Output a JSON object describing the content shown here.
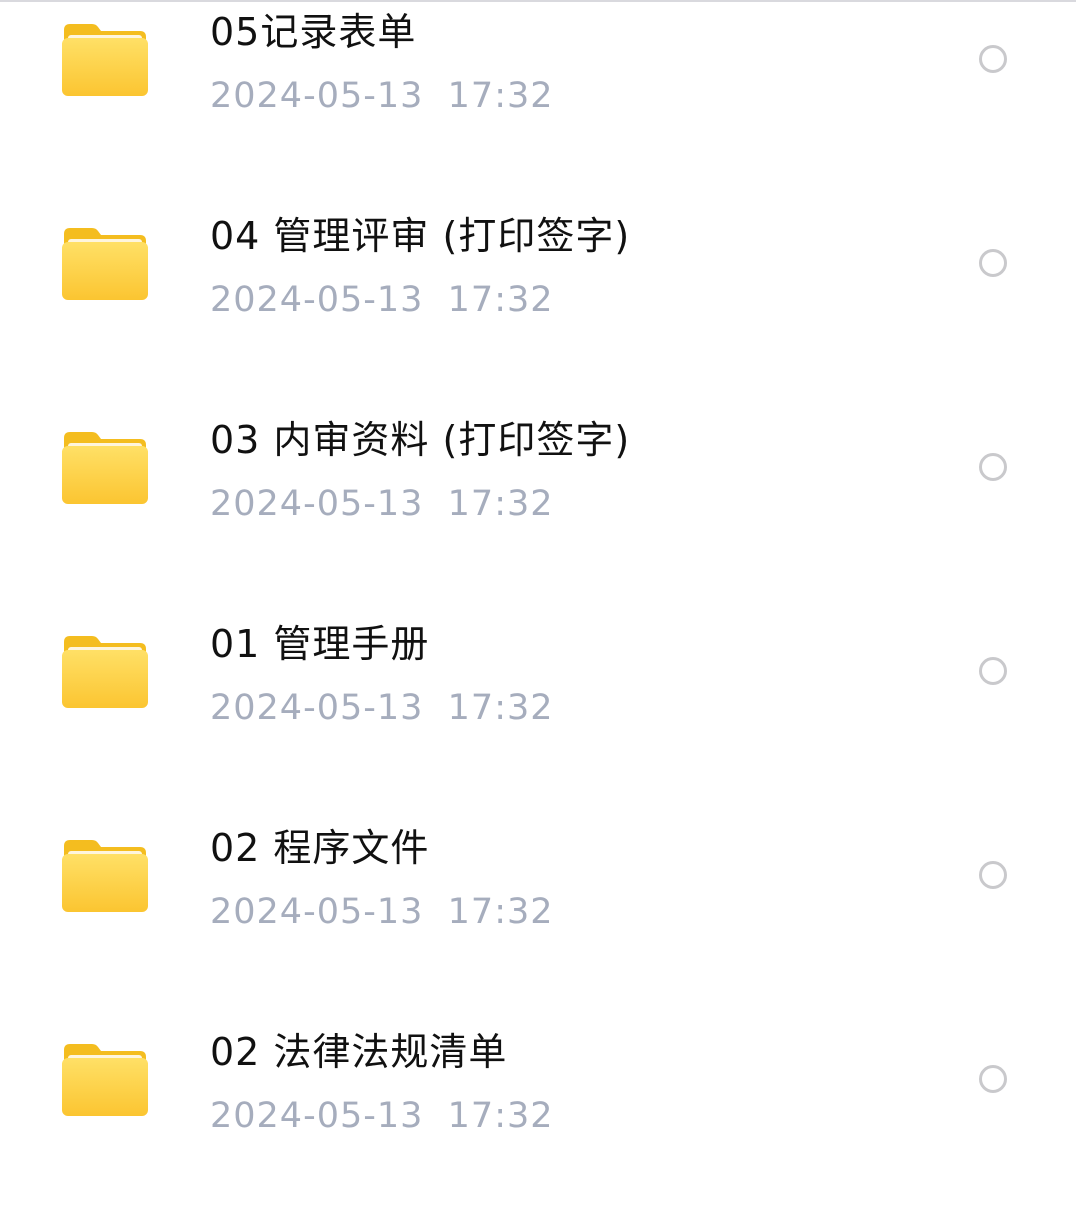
{
  "files": [
    {
      "name": "05记录表单",
      "date": "2024-05-13  17:32",
      "icon": "folder-icon",
      "selected": false
    },
    {
      "name": "04 管理评审 (打印签字)",
      "date": "2024-05-13  17:32",
      "icon": "folder-icon",
      "selected": false
    },
    {
      "name": "03 内审资料 (打印签字)",
      "date": "2024-05-13  17:32",
      "icon": "folder-icon",
      "selected": false
    },
    {
      "name": "01 管理手册",
      "date": "2024-05-13  17:32",
      "icon": "folder-icon",
      "selected": false
    },
    {
      "name": "02 程序文件",
      "date": "2024-05-13  17:32",
      "icon": "folder-icon",
      "selected": false
    },
    {
      "name": "02 法律法规清单",
      "date": "2024-05-13  17:32",
      "icon": "folder-icon",
      "selected": false
    }
  ],
  "colors": {
    "folder_front": "#fcd340",
    "folder_back": "#f6c123",
    "date_text": "#a6adbd",
    "radio_border": "#c9c9cc"
  }
}
